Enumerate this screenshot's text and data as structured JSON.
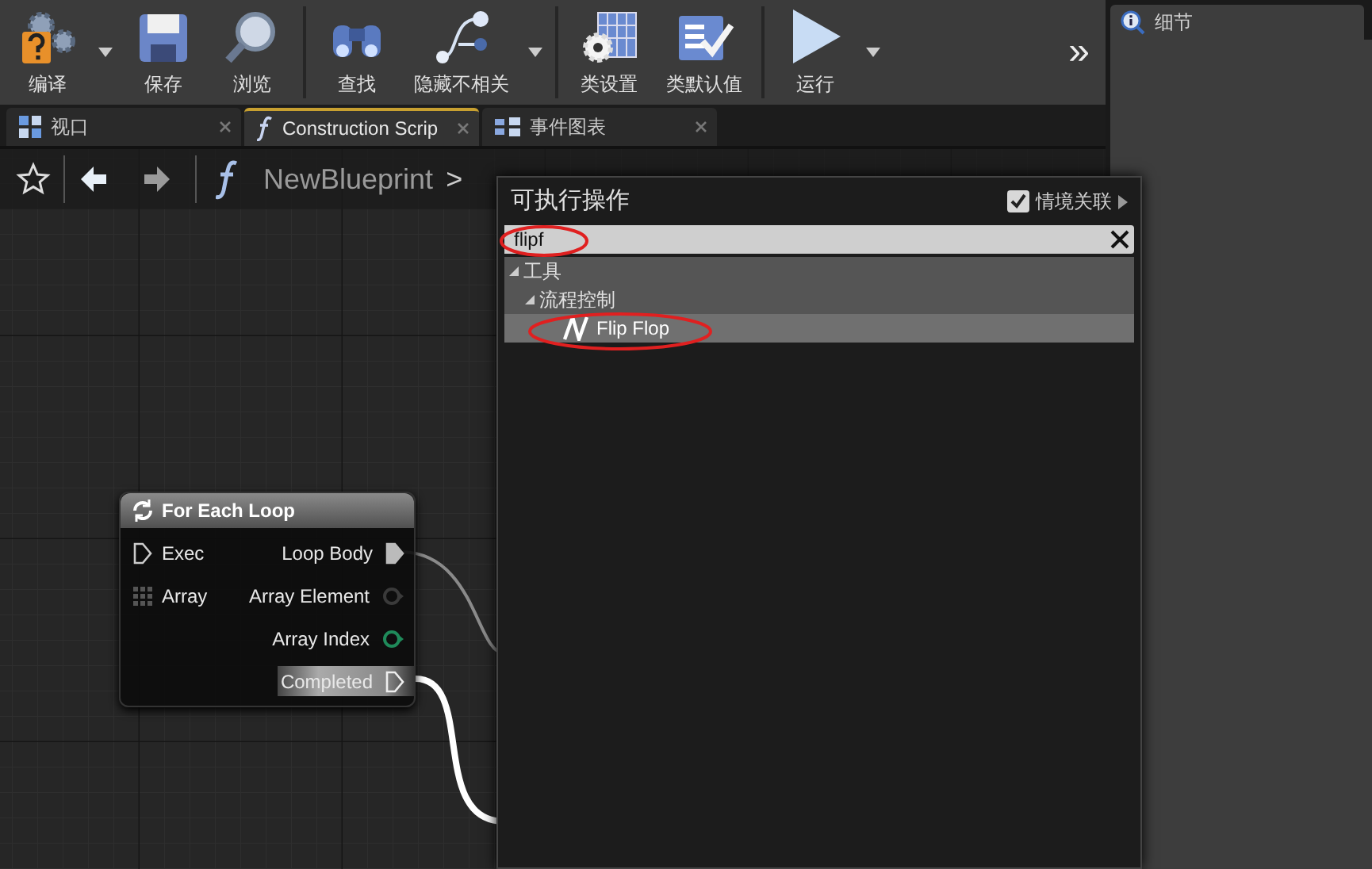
{
  "toolbar": {
    "buttons": [
      {
        "label": "编译",
        "dropdown": true
      },
      {
        "label": "保存",
        "dropdown": false
      },
      {
        "label": "浏览",
        "dropdown": false
      },
      {
        "label": "查找",
        "dropdown": false
      },
      {
        "label": "隐藏不相关",
        "dropdown": true
      },
      {
        "label": "类设置",
        "dropdown": false
      },
      {
        "label": "类默认值",
        "dropdown": false
      },
      {
        "label": "运行",
        "dropdown": true
      }
    ],
    "overflow": "»"
  },
  "tabs": [
    {
      "label": "视口",
      "selected": false
    },
    {
      "label": "Construction Scrip",
      "selected": true
    },
    {
      "label": "事件图表",
      "selected": false
    }
  ],
  "breadcrumb": {
    "blueprint": "NewBlueprint",
    "separator": ">"
  },
  "node": {
    "title": "For Each Loop",
    "inputs": [
      {
        "label": "Exec",
        "kind": "exec"
      },
      {
        "label": "Array",
        "kind": "array"
      }
    ],
    "outputs": [
      {
        "label": "Loop Body",
        "kind": "exec",
        "connected": true,
        "highlighted": false
      },
      {
        "label": "Array Element",
        "kind": "data",
        "color": "#3a3a3a",
        "connected": false,
        "highlighted": false
      },
      {
        "label": "Array Index",
        "kind": "data",
        "color": "#1f8a5a",
        "connected": false,
        "highlighted": false
      },
      {
        "label": "Completed",
        "kind": "exec",
        "connected": false,
        "highlighted": true
      }
    ]
  },
  "action_menu": {
    "title": "可执行操作",
    "context_sensitive": {
      "label": "情境关联",
      "checked": true
    },
    "search": {
      "value": "flipf"
    },
    "tree": [
      {
        "label": "工具",
        "expanded": true,
        "children": [
          {
            "label": "流程控制",
            "expanded": true,
            "children": [
              {
                "label": "Flip Flop",
                "selected": true
              }
            ]
          }
        ]
      }
    ]
  },
  "details_panel": {
    "tab": "细节"
  }
}
